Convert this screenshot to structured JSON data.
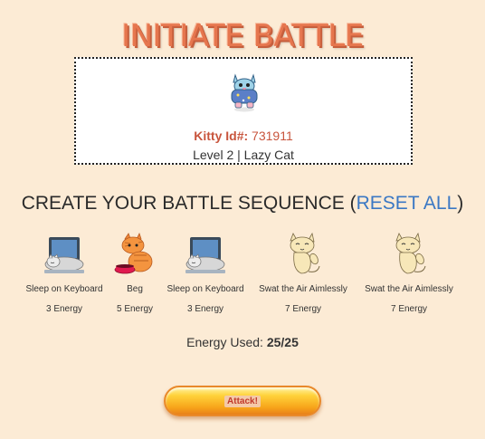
{
  "title": "INITIATE BATTLE",
  "kitty": {
    "id_label": "Kitty Id#:",
    "id_value": "731911",
    "level_text": "Level 2 | Lazy Cat"
  },
  "sequence": {
    "heading_before": "CREATE YOUR BATTLE SEQUENCE (",
    "reset_label": "RESET ALL",
    "heading_after": ")",
    "moves": [
      {
        "name": "Sleep on Keyboard",
        "energy": "3 Energy",
        "icon": "cat-on-laptop-icon"
      },
      {
        "name": "Beg",
        "energy": "5 Energy",
        "icon": "orange-cat-with-bowl-icon"
      },
      {
        "name": "Sleep on Keyboard",
        "energy": "3 Energy",
        "icon": "cat-on-laptop-icon"
      },
      {
        "name": "Swat the Air Aimlessly",
        "energy": "7 Energy",
        "icon": "cat-swatting-icon"
      },
      {
        "name": "Swat the Air Aimlessly",
        "energy": "7 Energy",
        "icon": "cat-swatting-icon"
      }
    ]
  },
  "energy": {
    "label": "Energy Used:",
    "value": "25/25"
  },
  "attack_label": "Attack!",
  "colors": {
    "background": "#fcebd5",
    "title": "#e6764e",
    "link": "#3b78c4",
    "kitty_id": "#c8553d"
  }
}
